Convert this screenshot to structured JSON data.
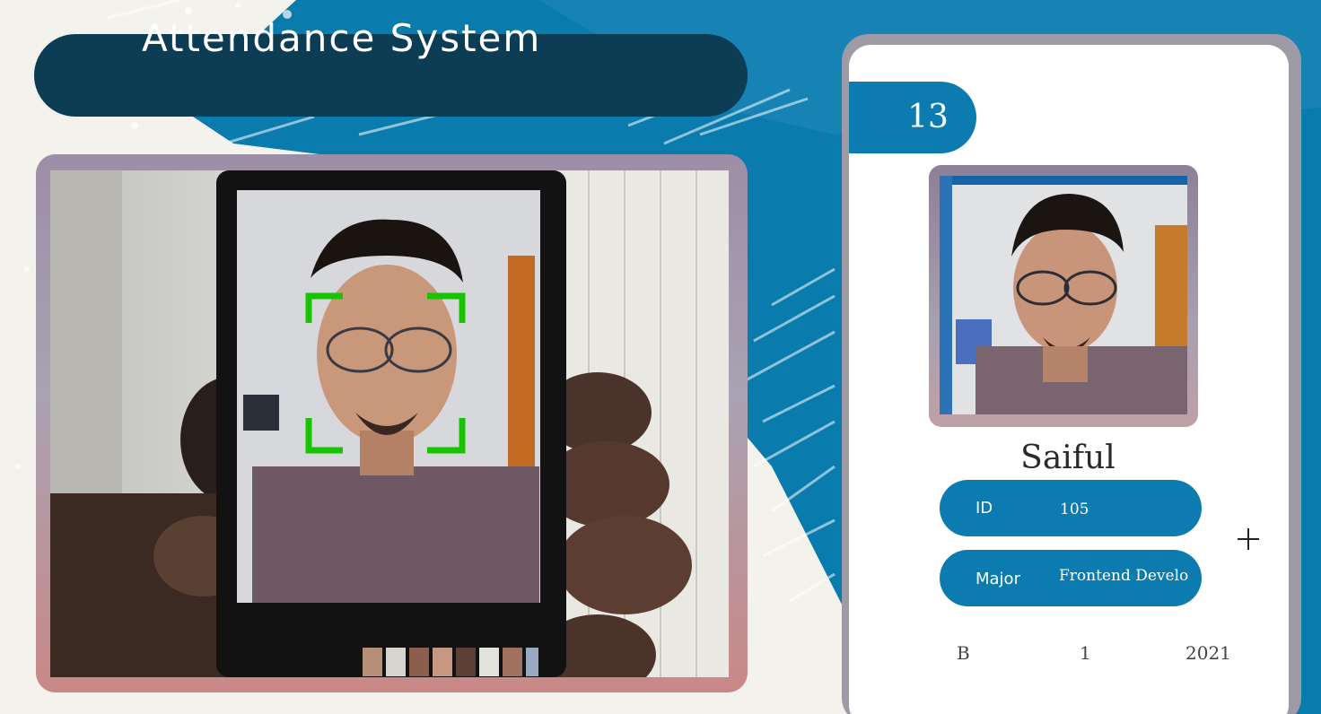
{
  "header": {
    "title": "Attendance System"
  },
  "camera": {
    "description_icon": "camera-feed",
    "detection_color": "#18c400"
  },
  "card": {
    "count": "13",
    "name": "Saiful",
    "id_label": "ID",
    "id_value": "105",
    "major_label": "Major",
    "major_value": "Frontend Develo",
    "standing": "B",
    "year": "1",
    "starting_year": "2021"
  },
  "colors": {
    "accent": "#0b7bb0",
    "banner": "#0d3c55",
    "frame": "#9e9aa6"
  }
}
